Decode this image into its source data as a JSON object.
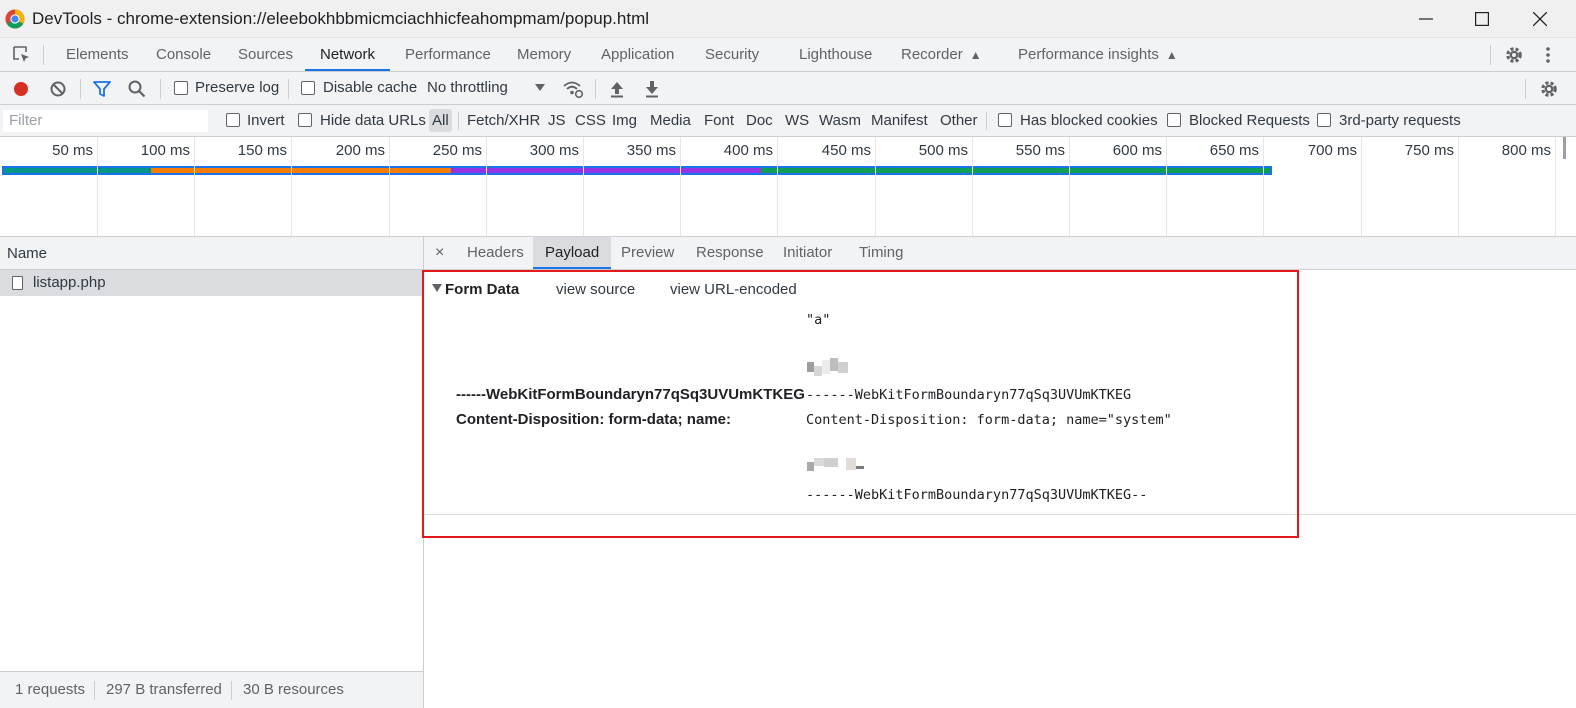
{
  "window": {
    "title": "DevTools - chrome-extension://eleebokhbbmicmciachhicfeahompmam/popup.html"
  },
  "main_tabs": [
    {
      "label": "Elements"
    },
    {
      "label": "Console"
    },
    {
      "label": "Sources"
    },
    {
      "label": "Network"
    },
    {
      "label": "Performance"
    },
    {
      "label": "Memory"
    },
    {
      "label": "Application"
    },
    {
      "label": "Security"
    },
    {
      "label": "Lighthouse"
    },
    {
      "label": "Recorder"
    },
    {
      "label": "Performance insights"
    }
  ],
  "toolbar": {
    "preserve_log": "Preserve log",
    "disable_cache": "Disable cache",
    "throttling": "No throttling"
  },
  "filter": {
    "placeholder": "Filter",
    "invert": "Invert",
    "hide_data_urls": "Hide data URLs",
    "types": [
      "All",
      "Fetch/XHR",
      "JS",
      "CSS",
      "Img",
      "Media",
      "Font",
      "Doc",
      "WS",
      "Wasm",
      "Manifest",
      "Other"
    ],
    "has_blocked_cookies": "Has blocked cookies",
    "blocked_requests": "Blocked Requests",
    "third_party": "3rd-party requests"
  },
  "overview": {
    "ticks": [
      "50 ms",
      "100 ms",
      "150 ms",
      "200 ms",
      "250 ms",
      "300 ms",
      "350 ms",
      "400 ms",
      "450 ms",
      "500 ms",
      "550 ms",
      "600 ms",
      "650 ms",
      "700 ms",
      "750 ms",
      "800 ms"
    ],
    "colors": {
      "blue": "#1a73e8",
      "teal": "#009688",
      "orange": "#f57c00",
      "purple": "#9334e6",
      "green": "#0f9d58"
    }
  },
  "requests": {
    "column_name": "Name",
    "items": [
      {
        "name": "listapp.php"
      }
    ]
  },
  "status": {
    "requests": "1 requests",
    "transferred": "297 B transferred",
    "resources": "30 B resources"
  },
  "detail_tabs": [
    "Headers",
    "Payload",
    "Preview",
    "Response",
    "Initiator",
    "Timing"
  ],
  "payload": {
    "section_title": "Form Data",
    "view_source": "view source",
    "view_url_encoded": "view URL-encoded",
    "rows": [
      {
        "key": "",
        "value": "\"a\""
      },
      {
        "key": "------WebKitFormBoundaryn77qSq3UVUmKTKEG",
        "value": "------WebKitFormBoundaryn77qSq3UVUmKTKEG"
      },
      {
        "key": "Content-Disposition: form-data; name:",
        "value": "Content-Disposition: form-data; name=\"system\""
      },
      {
        "key": "",
        "value": "------WebKitFormBoundaryn77qSq3UVUmKTKEG--"
      }
    ]
  }
}
